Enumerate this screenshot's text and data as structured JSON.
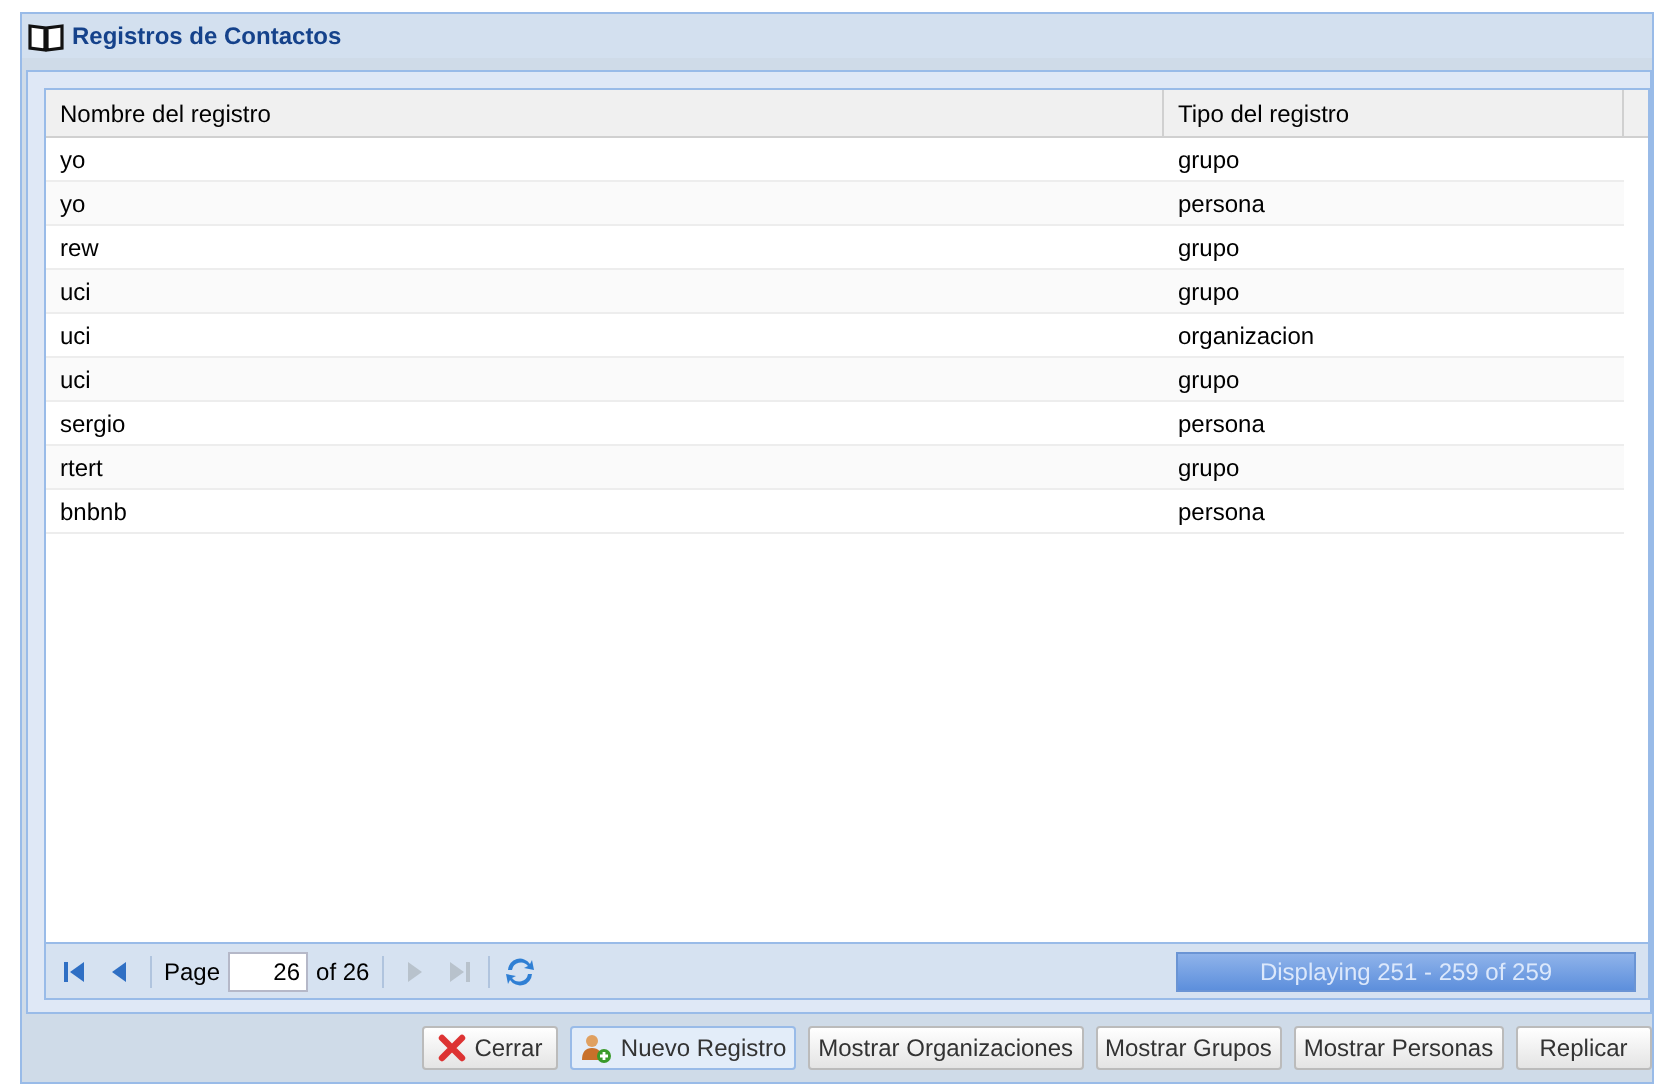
{
  "panel": {
    "title": "Registros de Contactos"
  },
  "table": {
    "columns": [
      "Nombre del registro",
      "Tipo del registro"
    ],
    "rows": [
      [
        "yo",
        "grupo"
      ],
      [
        "yo",
        "persona"
      ],
      [
        "rew",
        "grupo"
      ],
      [
        "uci",
        "grupo"
      ],
      [
        "uci",
        "organizacion"
      ],
      [
        "uci",
        "grupo"
      ],
      [
        "sergio",
        "persona"
      ],
      [
        "rtert",
        "grupo"
      ],
      [
        "bnbnb",
        "persona"
      ]
    ]
  },
  "pager": {
    "first_disabled": false,
    "prev_disabled": false,
    "next_disabled": true,
    "last_disabled": true,
    "page_label": "Page",
    "page": "26",
    "of": "of 26",
    "display": "Displaying 251 - 259 of 259"
  },
  "buttons": [
    {
      "label": "Cerrar",
      "kind": "close"
    },
    {
      "label": "Nuevo Registro",
      "kind": "add",
      "selected": true
    },
    {
      "label": "Mostrar Organizaciones",
      "kind": "plain"
    },
    {
      "label": "Mostrar Grupos",
      "kind": "plain"
    },
    {
      "label": "Mostrar Personas",
      "kind": "plain"
    },
    {
      "label": "Replicar",
      "kind": "wide"
    }
  ]
}
